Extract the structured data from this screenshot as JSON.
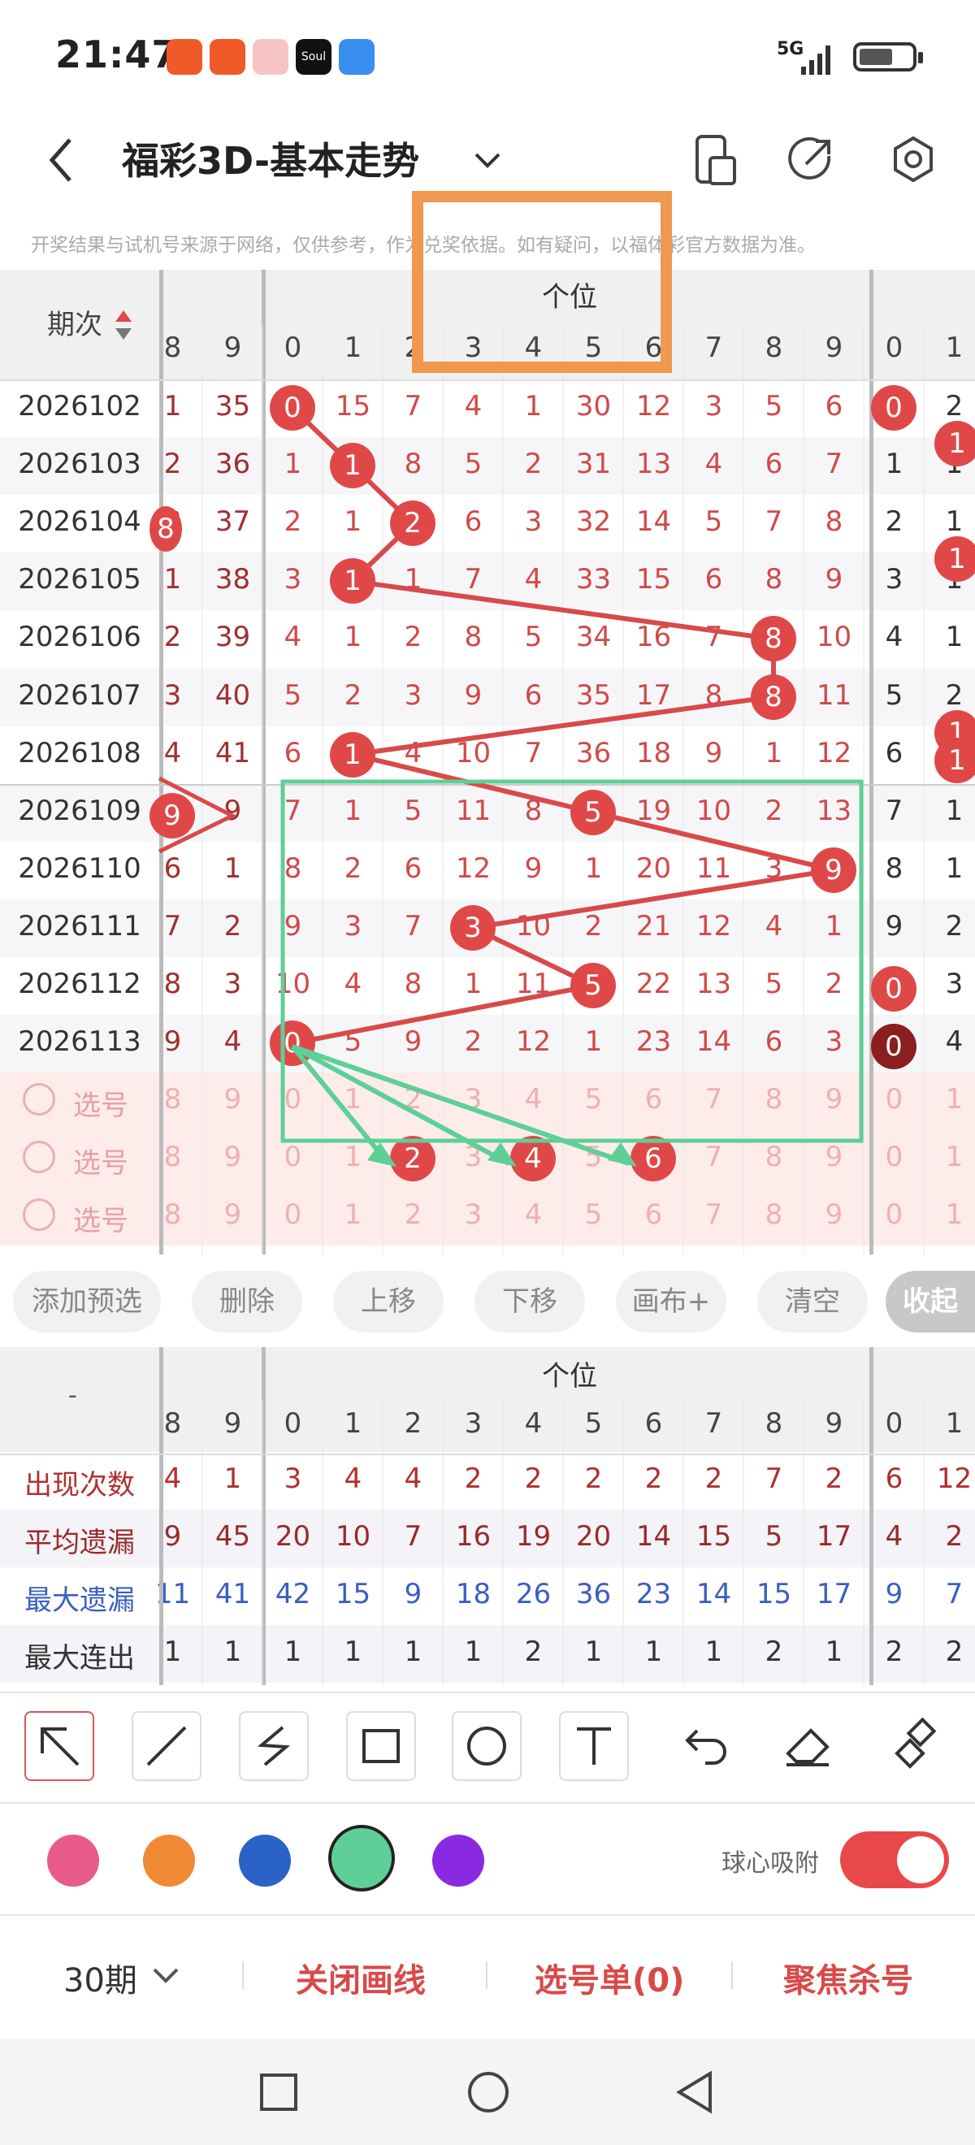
{
  "status_bar": {
    "time": "21:47",
    "network": "5G",
    "app_icons": [
      "kuaishou-icon",
      "kuaishou-icon-2",
      "game-icon",
      "soul-icon",
      "telegram-icon"
    ]
  },
  "header": {
    "title": "福彩3D-基本走势",
    "disclaimer": "开奖结果与试机号来源于网络，仅供参考，作为兑奖依据。如有疑问，以福体彩官方数据为准。"
  },
  "grid": {
    "period_label": "期次",
    "section_label": "个位",
    "col_headers": [
      "8",
      "9",
      "0",
      "1",
      "2",
      "3",
      "4",
      "5",
      "6",
      "7",
      "8",
      "9",
      "0",
      "1"
    ],
    "rows": [
      {
        "period": "2026102",
        "cells": [
          "1",
          "35",
          "0",
          "15",
          "7",
          "4",
          "1",
          "30",
          "12",
          "3",
          "5",
          "6",
          "0",
          "2"
        ]
      },
      {
        "period": "2026103",
        "cells": [
          "2",
          "36",
          "1",
          "1",
          "8",
          "5",
          "2",
          "31",
          "13",
          "4",
          "6",
          "7",
          "1",
          "1"
        ]
      },
      {
        "period": "2026104",
        "cells": [
          "8",
          "37",
          "2",
          "1",
          "2",
          "6",
          "3",
          "32",
          "14",
          "5",
          "7",
          "8",
          "2",
          "1"
        ]
      },
      {
        "period": "2026105",
        "cells": [
          "1",
          "38",
          "3",
          "1",
          "1",
          "7",
          "4",
          "33",
          "15",
          "6",
          "8",
          "9",
          "3",
          "1"
        ]
      },
      {
        "period": "2026106",
        "cells": [
          "2",
          "39",
          "4",
          "1",
          "2",
          "8",
          "5",
          "34",
          "16",
          "7",
          "8",
          "10",
          "4",
          "1"
        ]
      },
      {
        "period": "2026107",
        "cells": [
          "3",
          "40",
          "5",
          "2",
          "3",
          "9",
          "6",
          "35",
          "17",
          "8",
          "8",
          "11",
          "5",
          "2"
        ]
      },
      {
        "period": "2026108",
        "cells": [
          "4",
          "41",
          "6",
          "1",
          "4",
          "10",
          "7",
          "36",
          "18",
          "9",
          "1",
          "12",
          "6",
          "1"
        ]
      },
      {
        "period": "2026109",
        "cells": [
          "5",
          "9",
          "7",
          "1",
          "5",
          "11",
          "8",
          "5",
          "19",
          "10",
          "2",
          "13",
          "7",
          "1"
        ]
      },
      {
        "period": "2026110",
        "cells": [
          "6",
          "1",
          "8",
          "2",
          "6",
          "12",
          "9",
          "1",
          "20",
          "11",
          "3",
          "9",
          "8",
          "1"
        ]
      },
      {
        "period": "2026111",
        "cells": [
          "7",
          "2",
          "9",
          "3",
          "7",
          "3",
          "10",
          "2",
          "21",
          "12",
          "4",
          "1",
          "9",
          "2"
        ]
      },
      {
        "period": "2026112",
        "cells": [
          "8",
          "3",
          "10",
          "4",
          "8",
          "1",
          "11",
          "5",
          "22",
          "13",
          "5",
          "2",
          "0",
          "3"
        ]
      },
      {
        "period": "2026113",
        "cells": [
          "9",
          "4",
          "0",
          "5",
          "9",
          "2",
          "12",
          "1",
          "23",
          "14",
          "6",
          "3",
          "0",
          "4"
        ]
      }
    ],
    "select_label": "选号",
    "select_cells": [
      "8",
      "9",
      "0",
      "1",
      "2",
      "3",
      "4",
      "5",
      "6",
      "7",
      "8",
      "9",
      "0",
      "1"
    ]
  },
  "actions": {
    "add": "添加预选",
    "delete": "删除",
    "up": "上移",
    "down": "下移",
    "canvas": "画布+",
    "clear": "清空",
    "collapse": "收起"
  },
  "stats": {
    "corner": "-",
    "section_label": "个位",
    "col_headers": [
      "8",
      "9",
      "0",
      "1",
      "2",
      "3",
      "4",
      "5",
      "6",
      "7",
      "8",
      "9",
      "0",
      "1"
    ],
    "rows": [
      {
        "label": "出现次数",
        "color": "#b03030",
        "cells": [
          "4",
          "1",
          "3",
          "4",
          "4",
          "2",
          "2",
          "2",
          "2",
          "2",
          "7",
          "2",
          "6",
          "12"
        ]
      },
      {
        "label": "平均遗漏",
        "color": "#9a2a2a",
        "cells": [
          "9",
          "45",
          "20",
          "10",
          "7",
          "16",
          "19",
          "20",
          "14",
          "15",
          "5",
          "17",
          "4",
          "2"
        ]
      },
      {
        "label": "最大遗漏",
        "color": "#3a5fc0",
        "cells": [
          "11",
          "41",
          "42",
          "15",
          "9",
          "18",
          "26",
          "36",
          "23",
          "14",
          "15",
          "17",
          "9",
          "7"
        ]
      },
      {
        "label": "最大连出",
        "color": "#333333",
        "cells": [
          "1",
          "1",
          "1",
          "1",
          "1",
          "1",
          "2",
          "1",
          "1",
          "1",
          "2",
          "1",
          "2",
          "2"
        ]
      }
    ]
  },
  "toolbar": {
    "colors": [
      "#e85a8a",
      "#f08a34",
      "#2a62c8",
      "#5ecf96",
      "#8a2ae0"
    ],
    "snap_label": "球心吸附"
  },
  "bottom_bar": {
    "period_select": "30期",
    "close_lines": "关闭画线",
    "selection_list": "选号单(0)",
    "focus_kill": "聚焦杀号"
  }
}
